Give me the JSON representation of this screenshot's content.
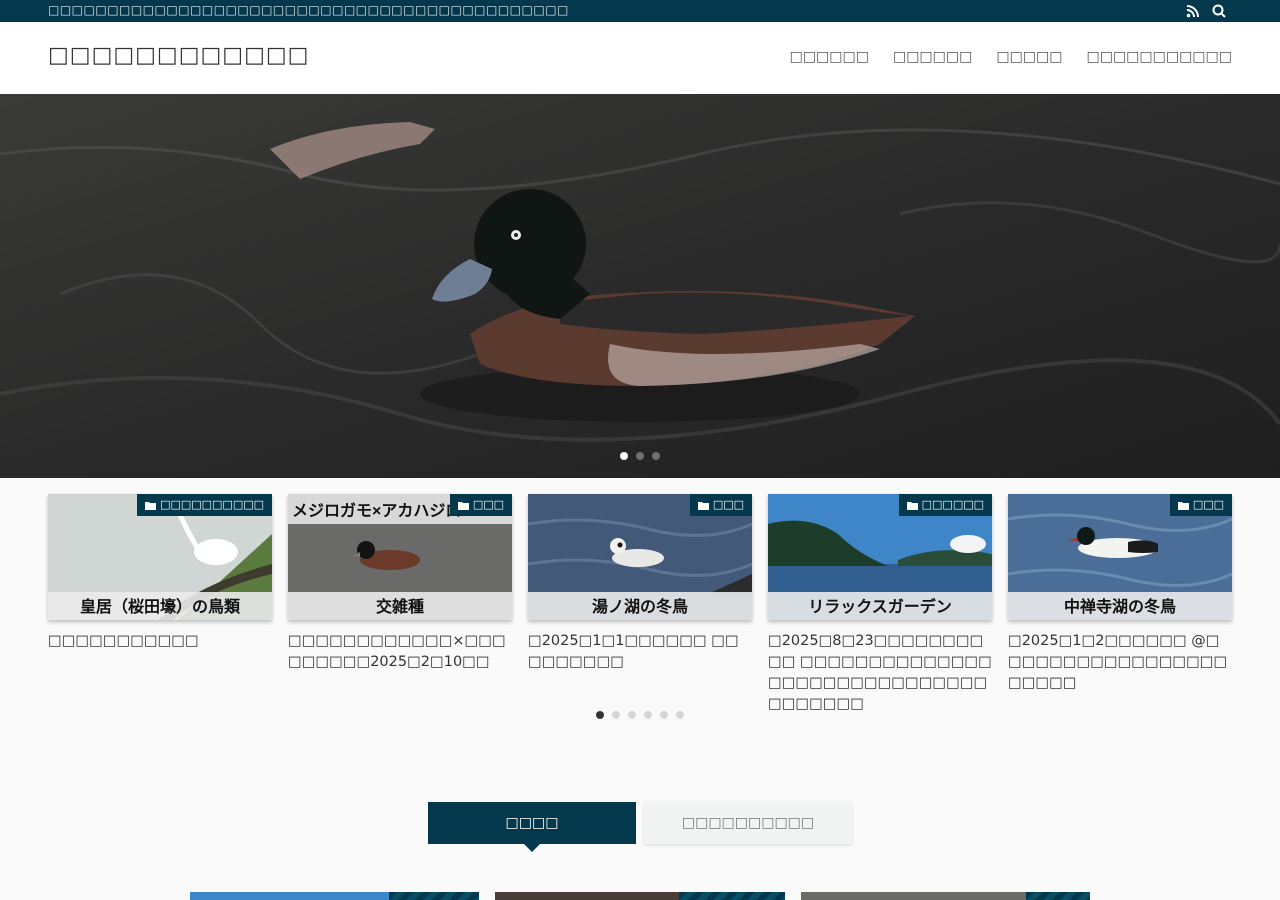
{
  "topbar": {
    "tagline": "□□□□□□□□□□□□□□□□□□□□□□□□□□□□□□□□□□□□□□□□□□□□",
    "rss_icon": "rss-icon",
    "search_icon": "search-icon"
  },
  "header": {
    "site_title": "□□□□□□□□□□□□",
    "nav": [
      "□□□□□□",
      "□□□□□□",
      "□□□□□",
      "□□□□□□□□□□□"
    ]
  },
  "hero": {
    "slide_count": 3,
    "active_slide": 0
  },
  "cards": [
    {
      "category": "□□□□□□□□□□",
      "caption": "皇居（桜田壕）の鳥類",
      "title": "□□□□□□□□□□□"
    },
    {
      "category": "□□□",
      "caption": "交雑種",
      "overlay_text": "メジロガモ×アカハジロ",
      "title": "□□□□□□□□□□□□×□□□□□□□□□2025□2□10□□"
    },
    {
      "category": "□□□",
      "caption": "湯ノ湖の冬鳥",
      "title": "□2025□1□1□□□□□□ □□□□□□□□□"
    },
    {
      "category": "□□□□□□",
      "caption": "リラックスガーデン",
      "title": "□2025□8□23□□□□□□□□□□ □□□□□□□□□□□□□□□□□□□□□□□□□□□□□□□□□□□□□"
    },
    {
      "category": "□□□",
      "caption": "中禅寺湖の冬鳥",
      "title": "□2025□1□2□□□□□□ @□□□□□□□□□□□□□□□□□□□□□□"
    }
  ],
  "carousel": {
    "dot_count": 6,
    "active_dot": 0
  },
  "tabs": {
    "active": "□□□□",
    "inactive": "□□□□□□□□□□"
  },
  "colors": {
    "brand": "#04384c",
    "page_bg": "#fafafa"
  }
}
